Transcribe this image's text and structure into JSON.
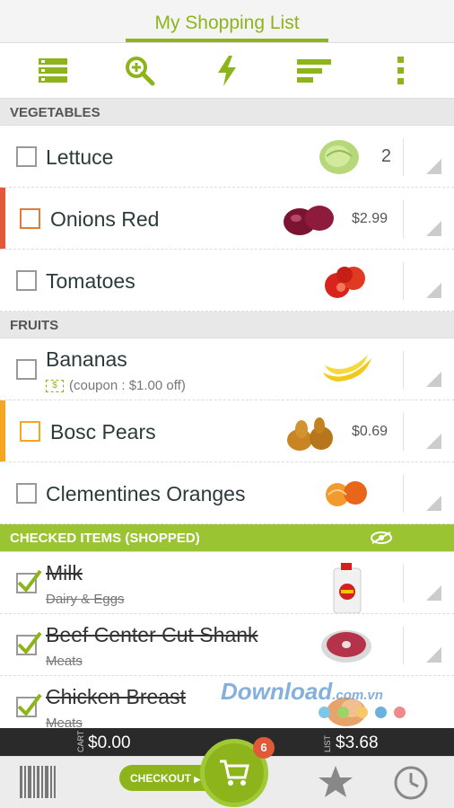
{
  "header": {
    "title": "My Shopping List"
  },
  "toolbar": {
    "icons": [
      "list-view-icon",
      "zoom-in-icon",
      "lightning-icon",
      "sort-icon",
      "more-vertical-icon"
    ],
    "accent": "#8db51b"
  },
  "sections": {
    "vegetables": "VEGETABLES",
    "fruits": "FRUITS",
    "checked": "CHECKED ITEMS (SHOPPED)"
  },
  "vegetables": [
    {
      "name": "Lettuce",
      "qty": "2"
    },
    {
      "name": "Onions Red",
      "price": "$2.99",
      "flag_color": "#e05a3a"
    },
    {
      "name": "Tomatoes"
    }
  ],
  "fruits": [
    {
      "name": "Bananas",
      "coupon_icon": "$",
      "coupon": "(coupon : $1.00 off)"
    },
    {
      "name": "Bosc Pears",
      "price": "$0.69",
      "flag_color": "#f5a623"
    },
    {
      "name": "Clementines Oranges"
    }
  ],
  "checked": [
    {
      "name": "Milk",
      "category": "Dairy & Eggs"
    },
    {
      "name": "Beef Center Cut Shank",
      "category": "Meats"
    },
    {
      "name": "Chicken Breast",
      "category": "Meats"
    }
  ],
  "totals": {
    "cart_label": "CART",
    "cart_value": "$0.00",
    "list_label": "LIST",
    "list_value": "$3.68"
  },
  "bottom": {
    "checkout_label": "CHECKOUT",
    "cart_badge": "6"
  },
  "watermark": {
    "text": "Download",
    "suffix": ".com.vn"
  },
  "colors": {
    "brand_green": "#8db51b",
    "section_grey": "#e8e8e8",
    "badge_red": "#e05a3a"
  }
}
